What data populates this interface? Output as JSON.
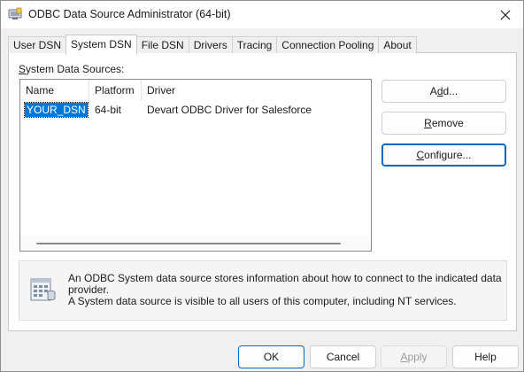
{
  "window": {
    "title": "ODBC Data Source Administrator (64-bit)"
  },
  "titlebar": {
    "icon": "odbc-app-icon",
    "close_icon": "close-icon"
  },
  "tabs": [
    {
      "label": "User DSN",
      "active": false
    },
    {
      "label": "System DSN",
      "active": true
    },
    {
      "label": "File DSN",
      "active": false
    },
    {
      "label": "Drivers",
      "active": false
    },
    {
      "label": "Tracing",
      "active": false
    },
    {
      "label": "Connection Pooling",
      "active": false
    },
    {
      "label": "About",
      "active": false
    }
  ],
  "system_dsn": {
    "label_mnemonic": "S",
    "label_rest": "ystem Data Sources:",
    "columns": [
      "Name",
      "Platform",
      "Driver"
    ],
    "rows": [
      {
        "name": "YOUR_DSN",
        "platform": "64-bit",
        "driver": "Devart ODBC Driver for Salesforce",
        "selected": true
      }
    ],
    "buttons": {
      "add": {
        "mnemonic": "d",
        "before": "A",
        "after": "d..."
      },
      "remove": {
        "before": "",
        "mnemonic": "R",
        "after": "emove"
      },
      "configure": {
        "before": "",
        "mnemonic": "C",
        "after": "onfigure..."
      }
    },
    "info_icon": "data-source-icon",
    "info_line1": "An ODBC System data source stores information about how to connect to the indicated data provider.",
    "info_line2": "A System data source is visible to all users of this computer, including NT services."
  },
  "footer": {
    "ok": "OK",
    "cancel": "Cancel",
    "apply": {
      "before": "",
      "mnemonic": "A",
      "after": "pply"
    },
    "help": "Help"
  }
}
